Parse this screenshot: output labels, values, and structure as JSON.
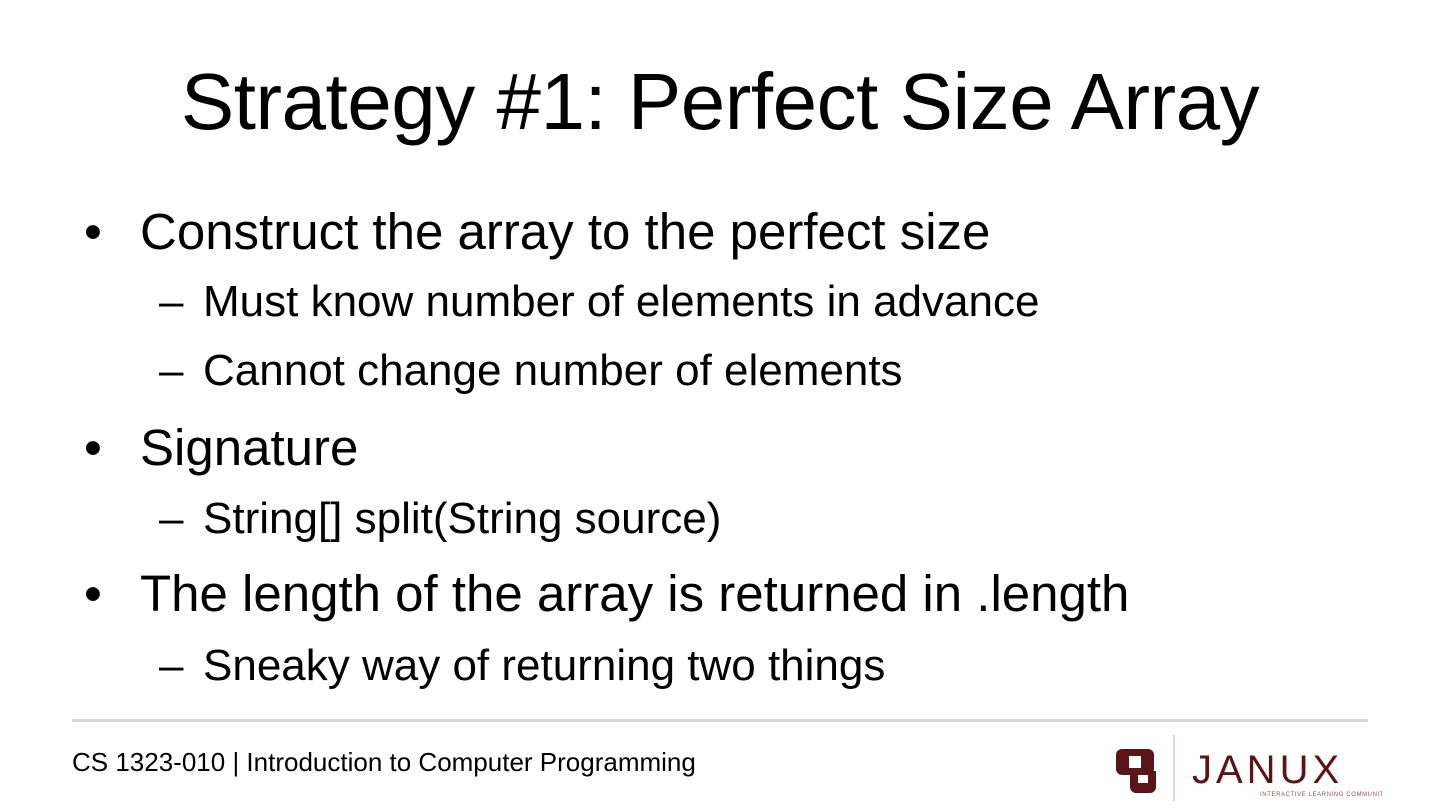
{
  "slide": {
    "title": "Strategy #1: Perfect Size Array",
    "bullet_glyph": "•",
    "sub_glyph": "–",
    "bullets": [
      {
        "text": "Construct the array to the perfect size",
        "subs": [
          "Must know number of elements in advance",
          "Cannot change number of elements"
        ]
      },
      {
        "text": "Signature",
        "subs": [
          "String[] split(String source)"
        ]
      },
      {
        "text": "The length of the array is returned in .length",
        "subs": [
          "Sneaky way of returning two things"
        ]
      }
    ]
  },
  "footer": {
    "course": "CS 1323-010 | Introduction to Computer Programming"
  },
  "logo": {
    "mark": "OU",
    "name": "JANUX",
    "tagline": "INTERACTIVE LEARNING COMMUNITY",
    "color": "#5a1518"
  }
}
